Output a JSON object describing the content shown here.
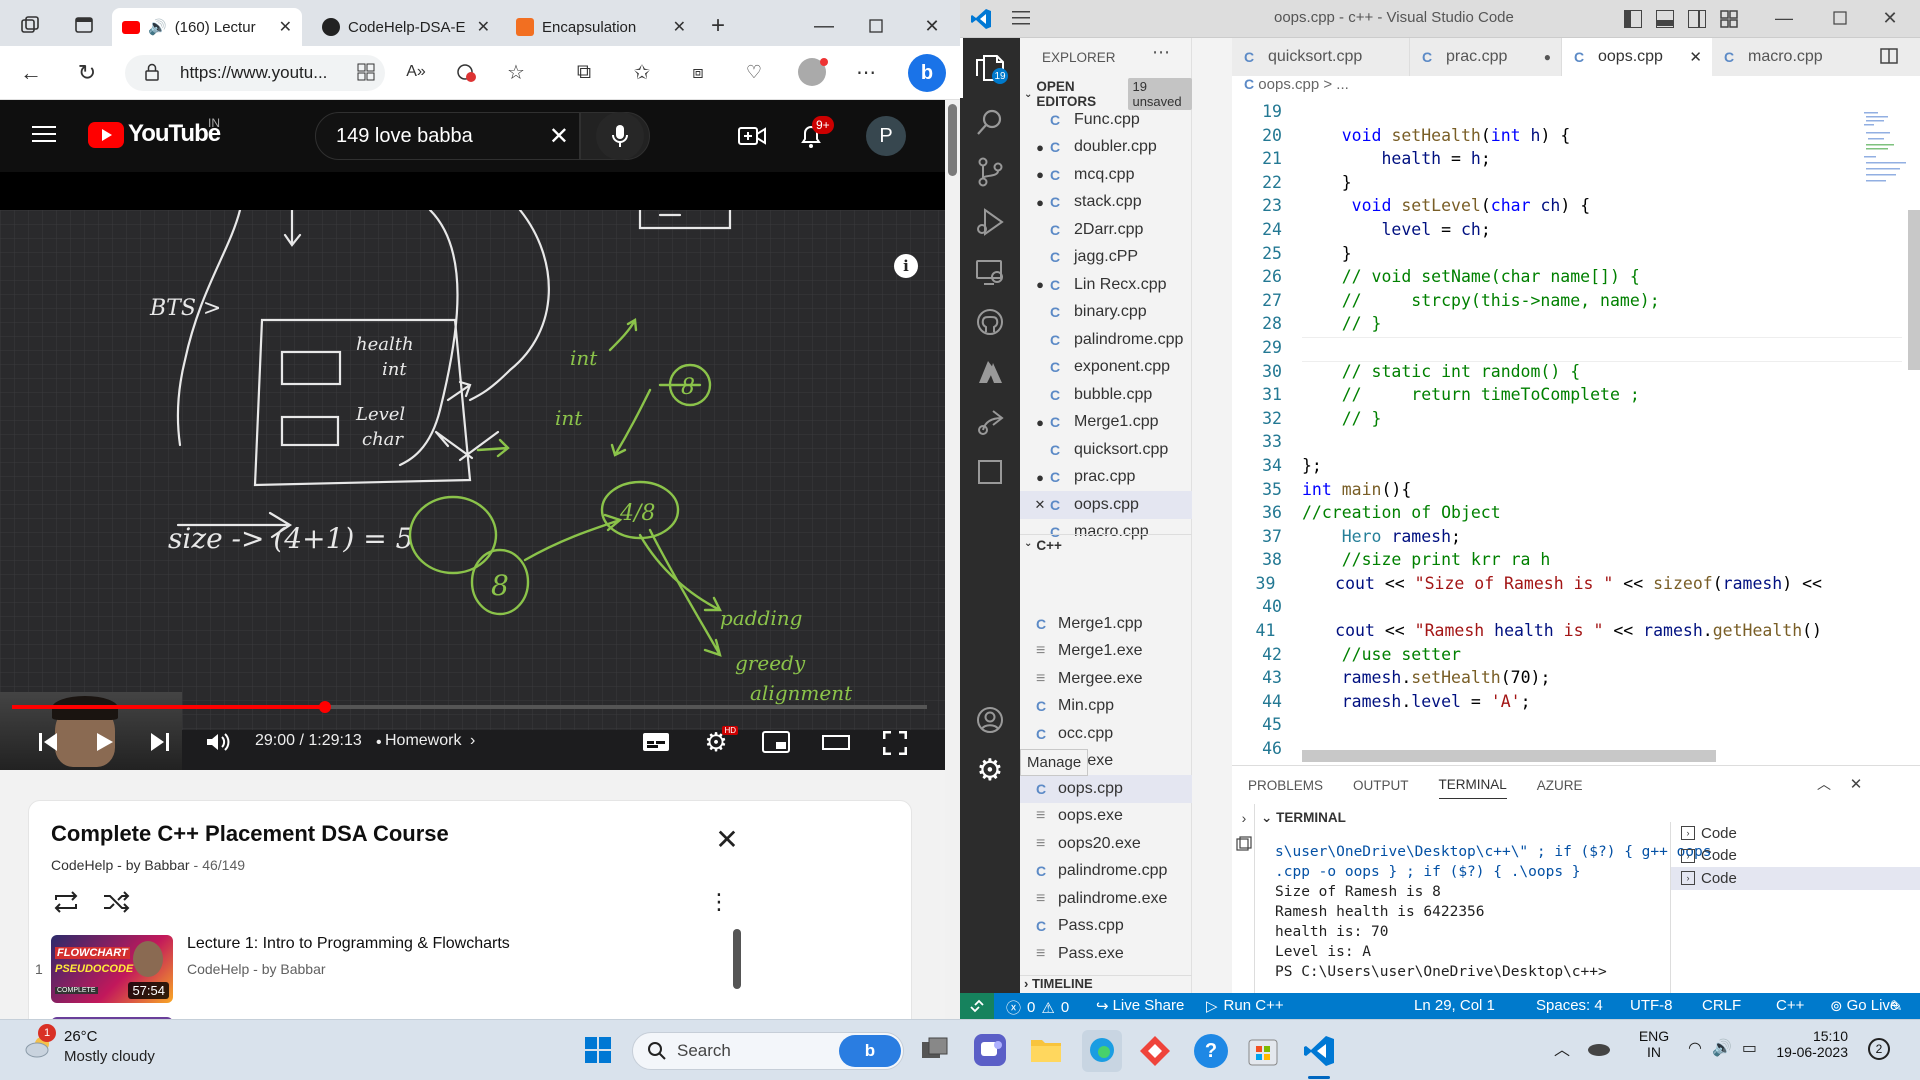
{
  "browser": {
    "tabs": [
      {
        "label": "(160) Lectur",
        "active": true
      },
      {
        "label": "CodeHelp-DSA-E",
        "active": false
      },
      {
        "label": "Encapsulation",
        "active": false
      }
    ],
    "url": "https://www.youtu..."
  },
  "youtube": {
    "logo": "YouTube",
    "region": "IN",
    "search": "149 love babba",
    "notif_count": "9+",
    "avatar": "P",
    "time": "29:00 / 1:29:13",
    "chapter": "Homework",
    "playlist_title": "Complete C++ Placement DSA Course",
    "playlist_channel": "CodeHelp - by Babbar",
    "playlist_pos": "46/149",
    "item": {
      "index": "1",
      "title": "Lecture 1: Intro to Programming & Flowcharts",
      "channel": "CodeHelp - by Babbar",
      "duration": "57:54",
      "thumb1": "FLOWCHART",
      "thumb2": "PSEUDOCODE",
      "thumb3": "COMPLETE"
    },
    "board": [
      "BTS >",
      "health",
      "int",
      "Level",
      "char",
      "int",
      "int",
      "8",
      "size -> (4+1) = 5",
      "4/8",
      "8",
      "padding",
      "greedy",
      "alignment"
    ]
  },
  "vscode": {
    "title": "oops.cpp - c++ - Visual Studio Code",
    "tabs": [
      "quicksort.cpp",
      "prac.cpp",
      "oops.cpp",
      "macro.cpp"
    ],
    "breadcrumb": "oops.cpp > ...",
    "explorer_title": "EXPLORER",
    "open_editors": "OPEN EDITORS",
    "unsaved": "19 unsaved",
    "activity_badge": "19",
    "open_files": [
      {
        "name": "Func.cpp",
        "mark": ""
      },
      {
        "name": "doubler.cpp",
        "mark": "●"
      },
      {
        "name": "mcq.cpp",
        "mark": "●"
      },
      {
        "name": "stack.cpp",
        "mark": "●"
      },
      {
        "name": "2Darr.cpp",
        "mark": ""
      },
      {
        "name": "jagg.cPP",
        "mark": ""
      },
      {
        "name": "Lin Recx.cpp",
        "mark": "●"
      },
      {
        "name": "binary.cpp",
        "mark": ""
      },
      {
        "name": "palindrome.cpp",
        "mark": ""
      },
      {
        "name": "exponent.cpp",
        "mark": ""
      },
      {
        "name": "bubble.cpp",
        "mark": ""
      },
      {
        "name": "Merge1.cpp",
        "mark": "●"
      },
      {
        "name": "quicksort.cpp",
        "mark": ""
      },
      {
        "name": "prac.cpp",
        "mark": "●"
      },
      {
        "name": "oops.cpp",
        "mark": "✕"
      },
      {
        "name": "macro.cpp",
        "mark": ""
      }
    ],
    "folder": "C++",
    "folder_files": [
      {
        "name": "Merge1.cpp",
        "t": "c"
      },
      {
        "name": "Merge1.exe",
        "t": "e"
      },
      {
        "name": "Mergee.exe",
        "t": "e"
      },
      {
        "name": "Min.cpp",
        "t": "c"
      },
      {
        "name": "occ.cpp",
        "t": "c"
      },
      {
        "name": "occ.exe",
        "t": "e"
      },
      {
        "name": "oops.cpp",
        "t": "c"
      },
      {
        "name": "oops.exe",
        "t": "e"
      },
      {
        "name": "oops20.exe",
        "t": "e"
      },
      {
        "name": "palindrome.cpp",
        "t": "c"
      },
      {
        "name": "palindrome.exe",
        "t": "e"
      },
      {
        "name": "Pass.cpp",
        "t": "c"
      },
      {
        "name": "Pass.exe",
        "t": "e"
      }
    ],
    "manage_tip": "Manage",
    "timeline": "TIMELINE",
    "code": [
      {
        "n": "19",
        "t": ""
      },
      {
        "n": "20",
        "t": "    void setHealth(int h) {"
      },
      {
        "n": "21",
        "t": "        health = h;"
      },
      {
        "n": "22",
        "t": "    }"
      },
      {
        "n": "23",
        "t": "     void setLevel(char ch) {"
      },
      {
        "n": "24",
        "t": "        level = ch;"
      },
      {
        "n": "25",
        "t": "    }"
      },
      {
        "n": "26",
        "t": "    // void setName(char name[]) {"
      },
      {
        "n": "27",
        "t": "    //     strcpy(this->name, name);"
      },
      {
        "n": "28",
        "t": "    // }"
      },
      {
        "n": "29",
        "t": ""
      },
      {
        "n": "30",
        "t": "    // static int random() {"
      },
      {
        "n": "31",
        "t": "    //     return timeToComplete ;"
      },
      {
        "n": "32",
        "t": "    // }"
      },
      {
        "n": "33",
        "t": ""
      },
      {
        "n": "34",
        "t": "};"
      },
      {
        "n": "35",
        "t": "int main(){"
      },
      {
        "n": "36",
        "t": "//creation of Object"
      },
      {
        "n": "37",
        "t": "    Hero ramesh;"
      },
      {
        "n": "38",
        "t": "    //size print krr ra h"
      },
      {
        "n": "39",
        "t": "    cout << \"Size of Ramesh is \" << sizeof(ramesh) <<"
      },
      {
        "n": "40",
        "t": ""
      },
      {
        "n": "41",
        "t": "    cout << \"Ramesh health is \" << ramesh.getHealth()"
      },
      {
        "n": "42",
        "t": "    //use setter"
      },
      {
        "n": "43",
        "t": "    ramesh.setHealth(70);"
      },
      {
        "n": "44",
        "t": "    ramesh.level = 'A';"
      },
      {
        "n": "45",
        "t": ""
      },
      {
        "n": "46",
        "t": ""
      }
    ],
    "panel_tabs": [
      "PROBLEMS",
      "OUTPUT",
      "TERMINAL",
      "AZURE"
    ],
    "terminal_header": "TERMINAL",
    "terminal": [
      "s\\user\\OneDrive\\Desktop\\c++\\\" ; if ($?) { g++ oops",
      ".cpp -o oops } ; if ($?) { .\\oops }",
      "Size of Ramesh is 8",
      "Ramesh health is 6422356",
      "health is: 70",
      "Level is: A",
      "PS C:\\Users\\user\\OneDrive\\Desktop\\c++>"
    ],
    "terminals": [
      "Code",
      "Code",
      "Code"
    ],
    "status": {
      "errors": "0",
      "warnings": "0",
      "live_share": "Live Share",
      "run": "Run C++",
      "pos": "Ln 29, Col 1",
      "spaces": "Spaces: 4",
      "enc": "UTF-8",
      "eol": "CRLF",
      "lang": "C++",
      "go_live": "Go Live"
    }
  },
  "taskbar": {
    "temp": "26°C",
    "weather": "Mostly cloudy",
    "weather_badge": "1",
    "search": "Search",
    "lang1": "ENG",
    "lang2": "IN",
    "time": "15:10",
    "date": "19-06-2023",
    "notif": "2"
  }
}
